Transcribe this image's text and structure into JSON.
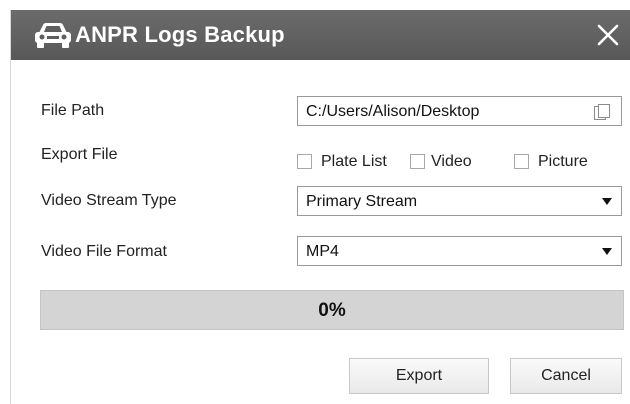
{
  "dialog": {
    "title": "ANPR Logs Backup",
    "title_icon": "car-icon",
    "close_icon": "close-icon"
  },
  "form": {
    "file_path": {
      "label": "File Path",
      "value": "C:/Users/Alison/Desktop",
      "icon": "folder-icon"
    },
    "export_file": {
      "label": "Export File",
      "options": [
        {
          "label": "Plate List",
          "checked": false
        },
        {
          "label": "Video",
          "checked": false
        },
        {
          "label": "Picture",
          "checked": false
        }
      ]
    },
    "video_stream_type": {
      "label": "Video Stream Type",
      "selected": "Primary Stream"
    },
    "video_file_format": {
      "label": "Video File Format",
      "selected": "MP4"
    }
  },
  "progress": {
    "text": "0%",
    "value": 0
  },
  "buttons": {
    "export_label": "Export",
    "cancel_label": "Cancel"
  },
  "colors": {
    "titlebar": "#5f5f5f",
    "progress_track": "#d4d4d4"
  }
}
